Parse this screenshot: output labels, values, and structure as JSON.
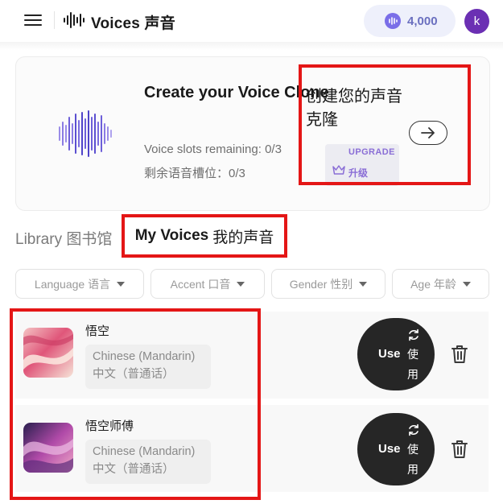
{
  "header": {
    "app_title": "Voices 声音",
    "credits": "4,000",
    "avatar_letter": "k"
  },
  "clone_card": {
    "title_en": "Create your Voice Clone",
    "title_zh_line1": "创建您的声音",
    "title_zh_line2": "克隆",
    "slots_en": "Voice slots remaining: 0/3",
    "slots_zh": "剩余语音槽位：0/3",
    "upgrade_en": "UPGRADE",
    "upgrade_zh": "升级"
  },
  "tabs": {
    "library": "Library 图书馆",
    "my_voices_en": "My Voices",
    "my_voices_zh": "我的声音"
  },
  "filters": [
    {
      "label": "Language 语言"
    },
    {
      "label": "Accent 口音"
    },
    {
      "label": "Gender 性别"
    },
    {
      "label": "Age 年龄"
    }
  ],
  "voices": [
    {
      "name": "悟空",
      "language_en": "Chinese (Mandarin)",
      "language_zh": "中文（普通话）",
      "use_label": "Use",
      "use_zh1": "使",
      "use_zh2": "用"
    },
    {
      "name": "悟空师傅",
      "language_en": "Chinese (Mandarin)",
      "language_zh": "中文（普通话）",
      "use_label": "Use",
      "use_zh1": "使",
      "use_zh2": "用"
    }
  ],
  "colors": {
    "accent": "#8a6ed6",
    "highlight_box": "#e41616",
    "avatar": "#6b2fb3",
    "use_button": "#262626"
  },
  "icons": [
    "menu-icon",
    "waveform-logo-icon",
    "coin-icon",
    "arrow-right-icon",
    "crown-icon",
    "caret-down-icon",
    "refresh-icon",
    "trash-icon"
  ]
}
